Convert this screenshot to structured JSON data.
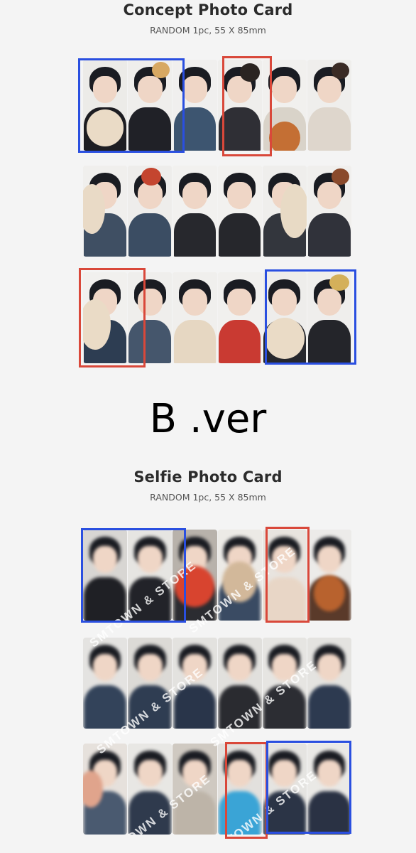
{
  "sections": [
    {
      "title": "Concept Photo Card",
      "subtitle": "RANDOM 1pc, 55 X 85mm"
    },
    {
      "title": "Selfie Photo Card",
      "subtitle": "RANDOM 1pc, 55 X 85mm",
      "watermark": "SMTOWN & STORE"
    }
  ],
  "version_label": "B .ver",
  "highlight_colors": {
    "blue": "#2a4fe0",
    "red": "#d9483a"
  }
}
